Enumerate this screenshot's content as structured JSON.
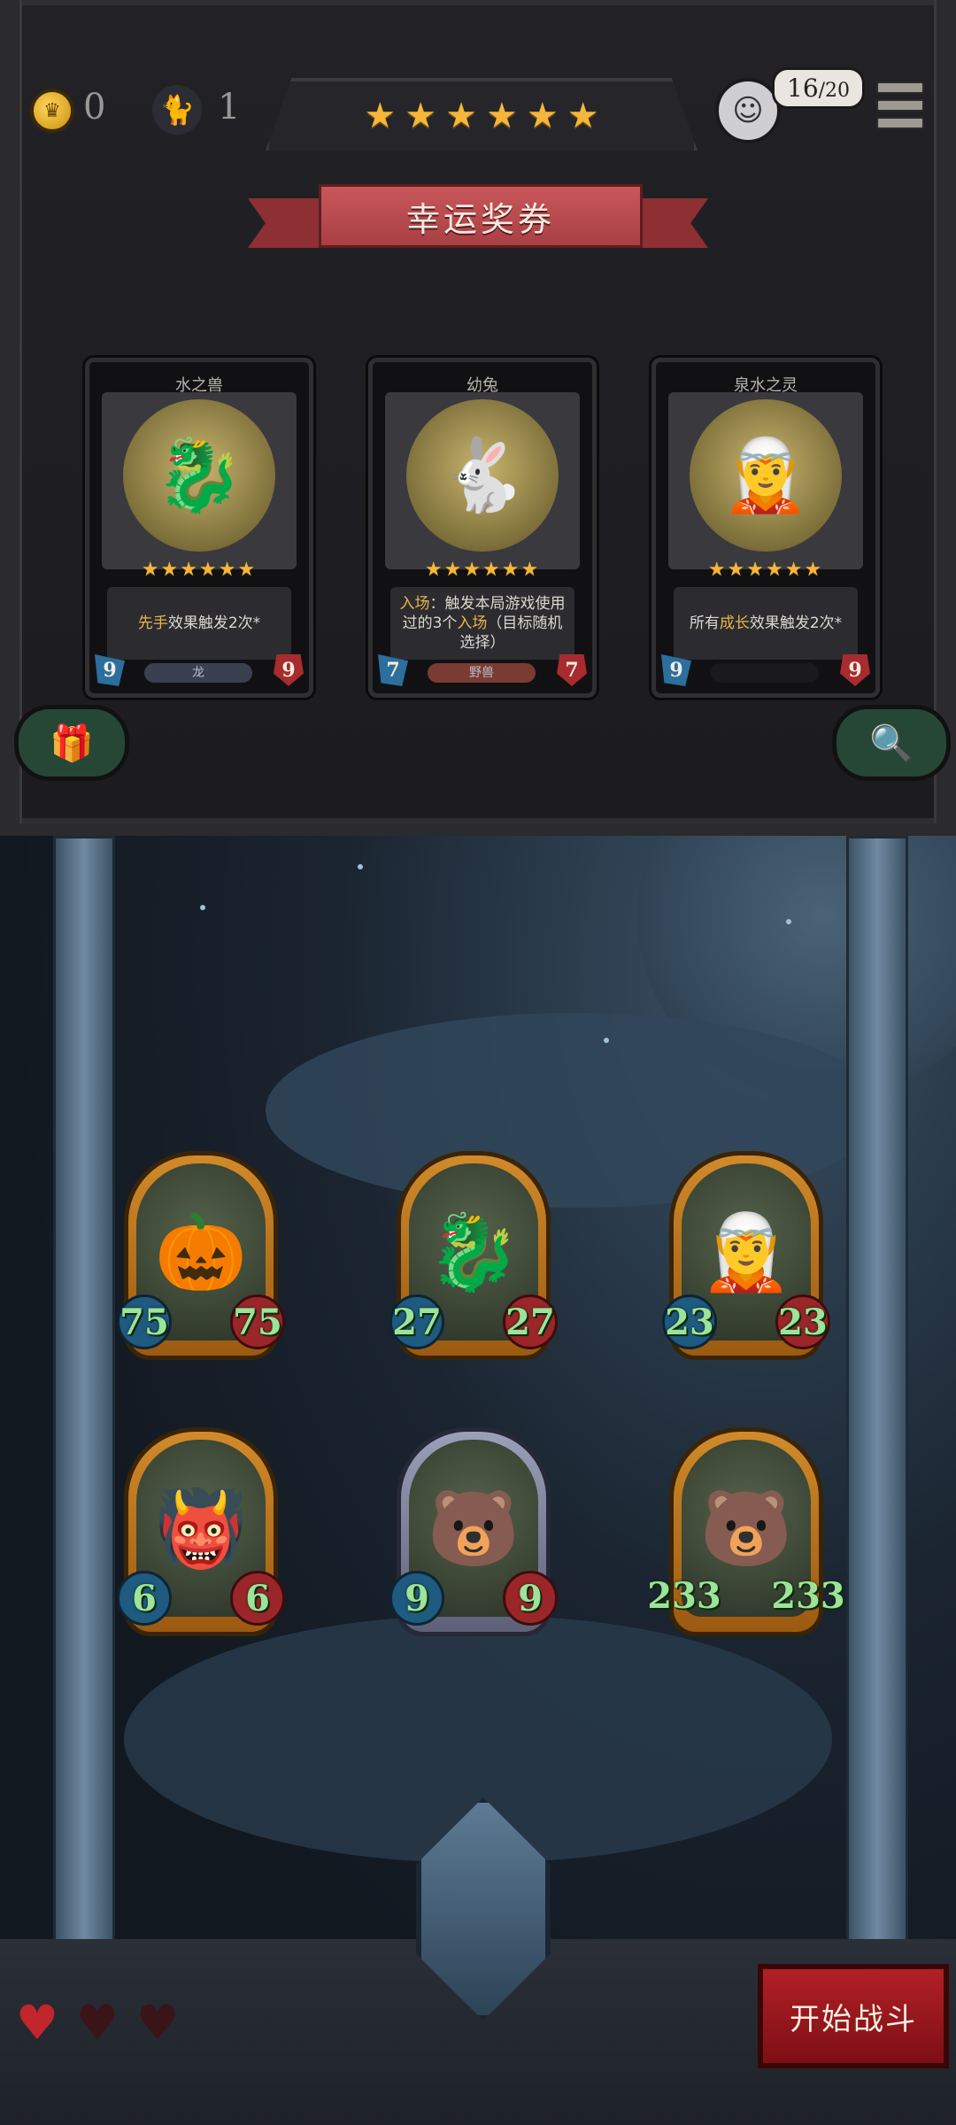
{
  "hud": {
    "gold": "0",
    "turn": "1",
    "tier_stars": 6,
    "star_glyph": "★",
    "player_count": "16",
    "player_total": "/20"
  },
  "panel": {
    "title": "幸运奖券",
    "cards": [
      {
        "name": "水之兽",
        "stars": "★★★★★★",
        "desc_parts": [
          {
            "t": "先手",
            "hl": true
          },
          {
            "t": "效果触发2次*",
            "hl": false
          }
        ],
        "attack": "9",
        "health": "9",
        "tribe": "龙",
        "icon": "dragon-beast-icon"
      },
      {
        "name": "幼兔",
        "stars": "★★★★★★",
        "desc_parts": [
          {
            "t": "入场",
            "hl": true
          },
          {
            "t": "：触发本局游戏使用过的3个",
            "hl": false
          },
          {
            "t": "入场",
            "hl": true
          },
          {
            "t": "（目标随机选择）",
            "hl": false
          }
        ],
        "attack": "7",
        "health": "7",
        "tribe": "野兽",
        "icon": "rabbit-icon"
      },
      {
        "name": "泉水之灵",
        "stars": "★★★★★★",
        "desc_parts": [
          {
            "t": "所有",
            "hl": false
          },
          {
            "t": "成长",
            "hl": true
          },
          {
            "t": "效果触发2次*",
            "hl": false
          }
        ],
        "attack": "9",
        "health": "9",
        "tribe": "",
        "icon": "elf-spirit-icon"
      }
    ]
  },
  "board": {
    "minions": [
      {
        "attack": "75",
        "health": "75",
        "frame": "gold",
        "icon": "pumpkin-monster-icon"
      },
      {
        "attack": "27",
        "health": "27",
        "frame": "gold",
        "icon": "dragon-beast-icon"
      },
      {
        "attack": "23",
        "health": "23",
        "frame": "gold",
        "icon": "elf-spirit-icon"
      },
      {
        "attack": "6",
        "health": "6",
        "frame": "gold",
        "icon": "swamp-monster-icon"
      },
      {
        "attack": "9",
        "health": "9",
        "frame": "silver",
        "icon": "bear-brute-icon"
      },
      {
        "attack": "233",
        "health": "233",
        "frame": "gold",
        "icon": "bear-brute-icon"
      }
    ]
  },
  "footer": {
    "lives": [
      true,
      false,
      false
    ],
    "start_button": "开始战斗"
  },
  "colors": {
    "star": "#f5b63a",
    "highlight": "#e8b54a",
    "stat_text": "#9de39a",
    "button_red": "#b12025"
  }
}
